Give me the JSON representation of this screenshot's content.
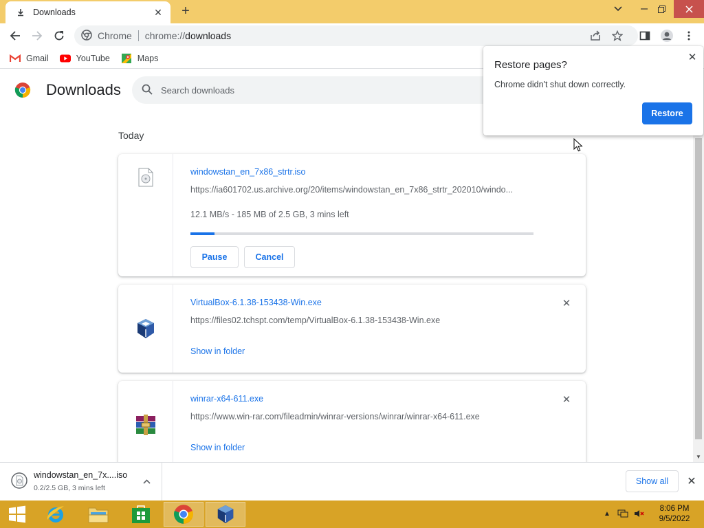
{
  "browser": {
    "tab_title": "Downloads",
    "omnibox": {
      "site_label": "Chrome",
      "url_scheme": "chrome://",
      "url_path": "downloads"
    },
    "bookmarks": [
      {
        "label": "Gmail",
        "icon": "gmail-icon"
      },
      {
        "label": "YouTube",
        "icon": "youtube-icon"
      },
      {
        "label": "Maps",
        "icon": "maps-icon"
      }
    ]
  },
  "page": {
    "title": "Downloads",
    "search_placeholder": "Search downloads",
    "section_label": "Today",
    "downloads": [
      {
        "filename": "windowstan_en_7x86_strtr.iso",
        "url": "https://ia601702.us.archive.org/20/items/windowstan_en_7x86_strtr_202010/windo...",
        "status": "12.1 MB/s - 185 MB of 2.5 GB, 3 mins left",
        "progress": 0.07,
        "pause_label": "Pause",
        "cancel_label": "Cancel"
      },
      {
        "filename": "VirtualBox-6.1.38-153438-Win.exe",
        "url": "https://files02.tchspt.com/temp/VirtualBox-6.1.38-153438-Win.exe",
        "action_label": "Show in folder"
      },
      {
        "filename": "winrar-x64-611.exe",
        "url": "https://www.win-rar.com/fileadmin/winrar-versions/winrar/winrar-x64-611.exe",
        "action_label": "Show in folder"
      }
    ]
  },
  "popup": {
    "title": "Restore pages?",
    "message": "Chrome didn't shut down correctly.",
    "button_label": "Restore"
  },
  "shelf": {
    "filename": "windowstan_en_7x....iso",
    "status": "0.2/2.5 GB, 3 mins left",
    "show_all_label": "Show all"
  },
  "taskbar": {
    "time": "8:06 PM",
    "date": "9/5/2022"
  },
  "colors": {
    "title_bar": "#f3cc6b",
    "accent": "#1a73e8",
    "taskbar": "#d8a326",
    "window_close": "#c7514d"
  }
}
